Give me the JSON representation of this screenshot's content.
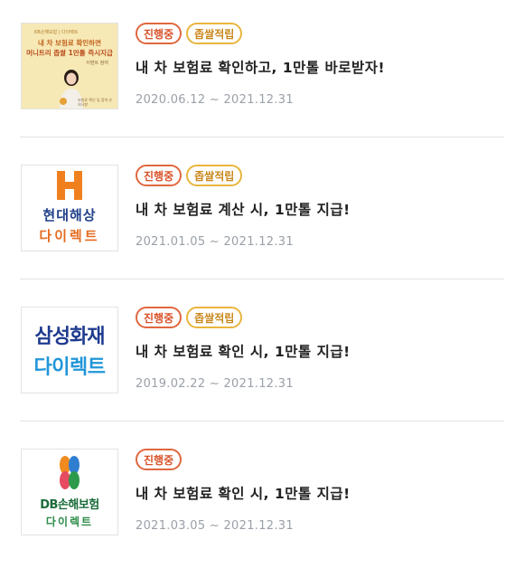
{
  "events": [
    {
      "badges": [
        "진행중",
        "좁쌀적립"
      ],
      "title": "내 차 보험료 확인하고, 1만톨 바로받자!",
      "period": "2020.06.12 ~ 2021.12.31",
      "thumb": {
        "brand": "KB손해보험 | 다이렉트",
        "line1": "내 차 보험료 확인하면",
        "line2": "머니트리 좁쌀 1만톨 즉시지급",
        "small": "이벤트 참여",
        "fine": "보험료 확인 및 참여 유의사항"
      }
    },
    {
      "badges": [
        "진행중",
        "좁쌀적립"
      ],
      "title": "내 차 보험료 계산 시, 1만톨 지급!",
      "period": "2021.01.05 ~ 2021.12.31",
      "logo": {
        "line1": "현대해상",
        "line2": "다이렉트"
      }
    },
    {
      "badges": [
        "진행중",
        "좁쌀적립"
      ],
      "title": "내 차 보험료 확인 시, 1만톨 지급!",
      "period": "2019.02.22 ~ 2021.12.31",
      "logo": {
        "line1": "삼성화재",
        "line2": "다이렉트"
      }
    },
    {
      "badges": [
        "진행중"
      ],
      "title": "내 차 보험료 확인 시, 1만톨 지급!",
      "period": "2021.03.05 ~ 2021.12.31",
      "logo": {
        "line1": "DB손해보험",
        "line2": "다이렉트"
      }
    }
  ],
  "colors": {
    "ongoing_badge": "#e0673f",
    "point_badge": "#e9b53d",
    "period_text": "#9aa0a8",
    "hyundai_orange": "#e56b1f",
    "samsung_navy": "#1f3b8f",
    "samsung_blue": "#2196d8",
    "db_green": "#1a6b3a"
  },
  "icons": [
    "hyundai-h-logo-icon",
    "db-logo-mark-icon",
    "person-figure-icon"
  ]
}
